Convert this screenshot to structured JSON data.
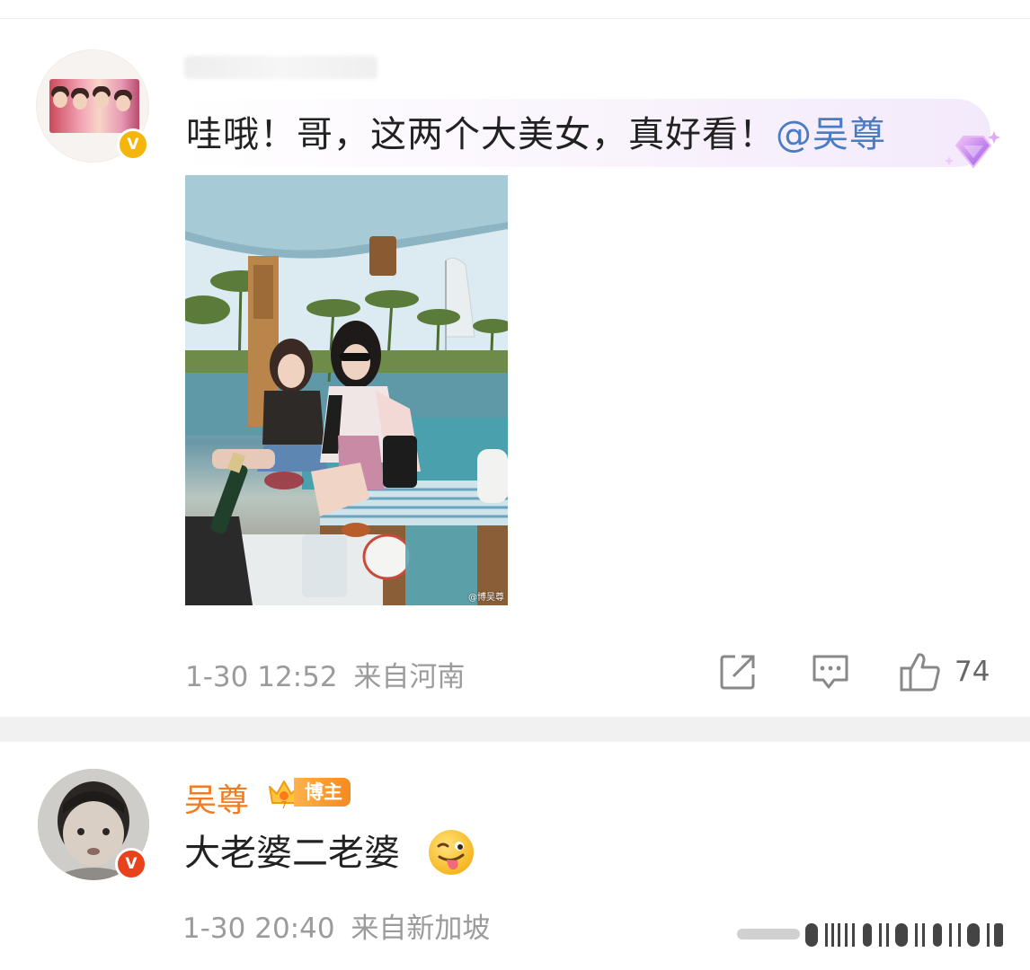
{
  "comment": {
    "text": "哇哦！哥，这两个大美女，真好看！",
    "mention": "@吴尊",
    "date": "1-30",
    "time": "12:52",
    "location": "来自河南",
    "like_count": "74",
    "image_watermark": "@博吴尊"
  },
  "reply": {
    "author": "吴尊",
    "badge_label": "博主",
    "badge_level": "7",
    "text": "大老婆二老婆",
    "date": "1-30",
    "time": "20:40",
    "location": "来自新加坡"
  },
  "icons": {
    "verified_badge": "V",
    "share": "share-icon",
    "reply": "comment-icon",
    "like": "thumbs-up-icon"
  },
  "colors": {
    "mention": "#4a7cc4",
    "author": "#f47b1e",
    "verified_yellow": "#f5b50b",
    "verified_red": "#e8421c",
    "meta_text": "#9b9b9b"
  }
}
